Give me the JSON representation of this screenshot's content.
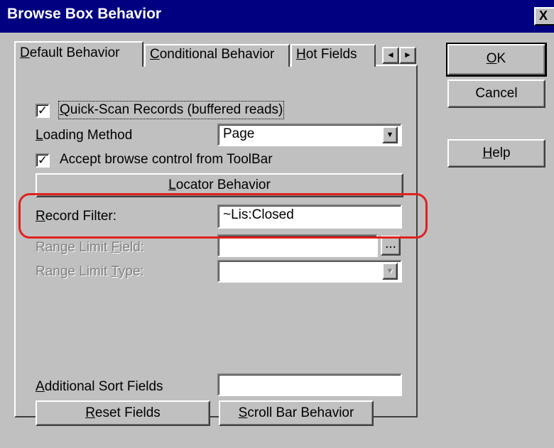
{
  "window": {
    "title": "Browse Box Behavior",
    "close_glyph": "X"
  },
  "tabs": [
    {
      "label": "Default Behavior",
      "mnemonic": "D",
      "rest": "efault Behavior",
      "active": true
    },
    {
      "label": "Conditional Behavior",
      "mnemonic": "C",
      "rest": "onditional Behavior",
      "active": false
    },
    {
      "label": "Hot Fields",
      "mnemonic": "H",
      "rest": "ot Fields",
      "active": false
    }
  ],
  "tab_scroll": {
    "left_icon": "◄",
    "right_icon": "►"
  },
  "default_behavior": {
    "quick_scan": {
      "label": "Quick-Scan Records (buffered reads)",
      "mnemonic": "Q",
      "rest": "uick-Scan Records (buffered reads)",
      "checked": true
    },
    "loading_method": {
      "label": "Loading Method",
      "mnemonic": "L",
      "rest": "oading Method",
      "value": "Page"
    },
    "accept_toolbar": {
      "label": "Accept browse control from ToolBar",
      "checked": true
    },
    "locator_button": {
      "label": "Locator Behavior",
      "mnemonic": "L",
      "rest": "ocator Behavior"
    },
    "record_filter": {
      "label": "Record Filter:",
      "mnemonic": "R",
      "rest": "ecord Filter:",
      "value": "~Lis:Closed"
    },
    "range_limit_field": {
      "label": "Range Limit Field:",
      "pre": "Range Limit ",
      "mnemonic": "F",
      "rest": "ield:",
      "value": "",
      "ellipsis": "..."
    },
    "range_limit_type": {
      "label": "Range Limit Type:",
      "pre": "Range Limit ",
      "mnemonic": "T",
      "rest": "ype:",
      "value": ""
    },
    "additional_sort": {
      "label": "Additional Sort Fields",
      "mnemonic": "A",
      "rest": "dditional Sort Fields",
      "value": ""
    },
    "reset_button": {
      "label": "Reset Fields",
      "mnemonic": "R",
      "rest": "eset Fields"
    },
    "scrollbar_button": {
      "label": "Scroll Bar Behavior",
      "mnemonic": "S",
      "rest": "croll Bar Behavior"
    }
  },
  "buttons": {
    "ok": {
      "label": "OK",
      "mnemonic": "O",
      "rest": "K"
    },
    "cancel": {
      "label": "Cancel"
    },
    "help": {
      "label": "Help",
      "mnemonic": "H",
      "rest": "elp"
    }
  },
  "icons": {
    "checkmark": "✓",
    "dropdown": "▼"
  },
  "colors": {
    "title_bar": "#000080",
    "highlight": "#e02020",
    "face": "#c0c0c0"
  }
}
